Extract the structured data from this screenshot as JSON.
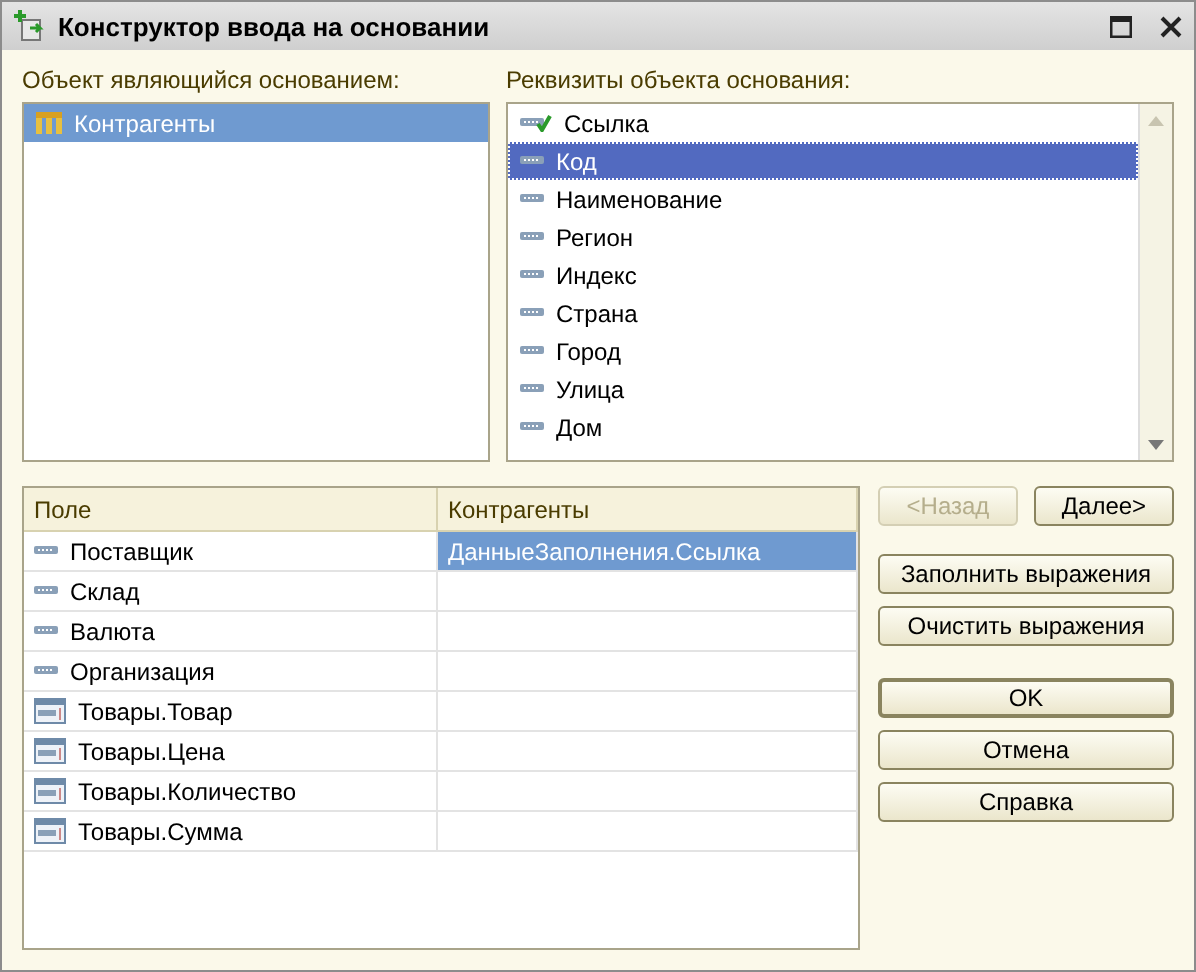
{
  "window": {
    "title": "Конструктор ввода на основании"
  },
  "base_object": {
    "label": "Объект являющийся основанием:",
    "items": [
      {
        "name": "Контрагенты",
        "selected": true
      }
    ]
  },
  "attributes": {
    "label": "Реквизиты объекта основания:",
    "items": [
      {
        "name": "Ссылка",
        "kind": "ref",
        "selected": false
      },
      {
        "name": "Код",
        "kind": "field",
        "selected": true
      },
      {
        "name": "Наименование",
        "kind": "field",
        "selected": false
      },
      {
        "name": "Регион",
        "kind": "field",
        "selected": false
      },
      {
        "name": "Индекс",
        "kind": "field",
        "selected": false
      },
      {
        "name": "Страна",
        "kind": "field",
        "selected": false
      },
      {
        "name": "Город",
        "kind": "field",
        "selected": false
      },
      {
        "name": "Улица",
        "kind": "field",
        "selected": false
      },
      {
        "name": "Дом",
        "kind": "field",
        "selected": false
      }
    ]
  },
  "table": {
    "columns": [
      "Поле",
      "Контрагенты"
    ],
    "rows": [
      {
        "field": "Поставщик",
        "kind": "field",
        "value": "ДанныеЗаполнения.Ссылка",
        "selected": true
      },
      {
        "field": "Склад",
        "kind": "field",
        "selected": false
      },
      {
        "field": "Валюта",
        "kind": "field",
        "selected": false
      },
      {
        "field": "Организация",
        "kind": "field",
        "selected": false
      },
      {
        "field": "Товары.Товар",
        "kind": "table",
        "selected": false
      },
      {
        "field": "Товары.Цена",
        "kind": "table",
        "selected": false
      },
      {
        "field": "Товары.Количество",
        "kind": "table",
        "selected": false
      },
      {
        "field": "Товары.Сумма",
        "kind": "table",
        "selected": false
      }
    ]
  },
  "nav_buttons": [
    {
      "label": "<Назад",
      "disabled": true
    },
    {
      "label": "Далее>",
      "disabled": false
    }
  ],
  "action_buttons": [
    {
      "label": "Заполнить выражения"
    },
    {
      "label": "Очистить выражения"
    }
  ],
  "dialog_buttons": [
    {
      "label": "OK",
      "default": true
    },
    {
      "label": "Отмена",
      "default": false
    },
    {
      "label": "Справка",
      "default": false
    }
  ]
}
